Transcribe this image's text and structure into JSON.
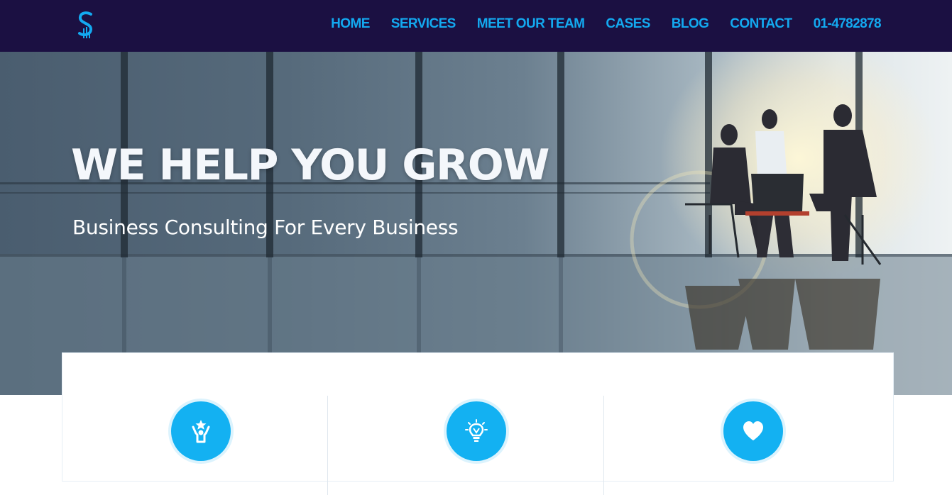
{
  "brand": {
    "logo_icon": "s-logo-icon",
    "logo_color": "#13a9f0"
  },
  "nav": {
    "background": "#1b1042",
    "link_color": "#13a9f0",
    "items": [
      "HOME",
      "SERVICES",
      "MEET OUR TEAM",
      "CASES",
      "BLOG",
      "CONTACT",
      "01-4782878"
    ]
  },
  "hero": {
    "title": "WE HELP YOU GROW",
    "subtitle": "Business Consulting For Every Business",
    "image": "office-handshake-photo"
  },
  "features": {
    "accent": "#13b1f2",
    "items": [
      {
        "icon": "winner-person-icon"
      },
      {
        "icon": "lightbulb-idea-icon"
      },
      {
        "icon": "heart-icon"
      }
    ]
  }
}
